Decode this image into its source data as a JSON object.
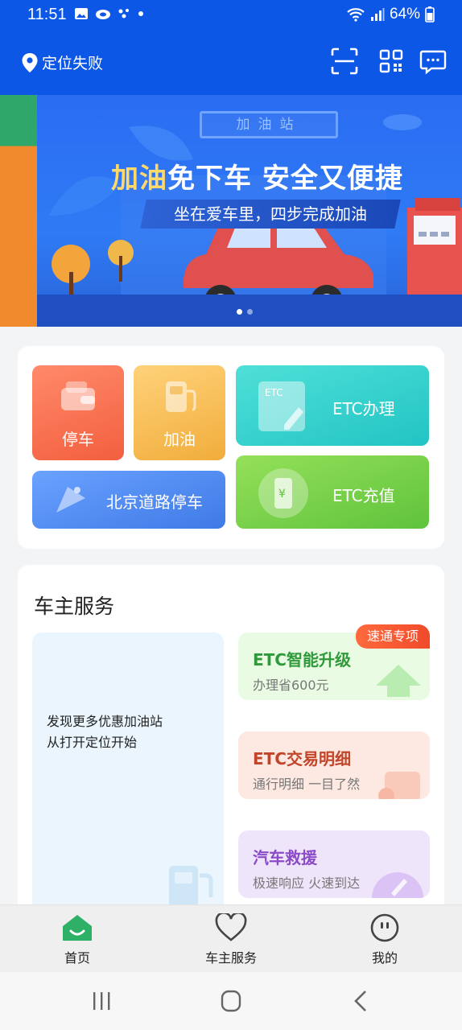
{
  "status_bar": {
    "time": "11:51",
    "battery": "64%"
  },
  "header": {
    "location_text": "定位失败",
    "icons": [
      "location-pin-icon",
      "scan-icon",
      "qrcode-icon",
      "message-icon"
    ]
  },
  "banner": {
    "station_sign": "加油站",
    "headline_highlight": "加油",
    "headline_rest": "免下车 安全又便捷",
    "subline": "坐在爱车里，四步完成加油",
    "slide_count": 2,
    "active_slide": 1
  },
  "quick_actions": {
    "parking": "停车",
    "fuel": "加油",
    "etc_apply": "ETC办理",
    "etc_recharge": "ETC充值",
    "beijing_parking": "北京道路停车"
  },
  "services": {
    "title": "车主服务",
    "map_message_line1": "发现更多优惠加油站",
    "map_message_line2": "从打开定位开始",
    "badge": "速通专项",
    "items": [
      {
        "title": "ETC智能升级",
        "subtitle": "办理省600元"
      },
      {
        "title": "ETC交易明细",
        "subtitle": "通行明细 一目了然"
      },
      {
        "title": "汽车救援",
        "subtitle": "极速响应 火速到达"
      }
    ]
  },
  "bottom_nav": {
    "home": "首页",
    "services": "车主服务",
    "mine": "我的",
    "active": "home"
  },
  "colors": {
    "brand_blue": "#0d57e6",
    "active_nav": "#2fb067"
  }
}
